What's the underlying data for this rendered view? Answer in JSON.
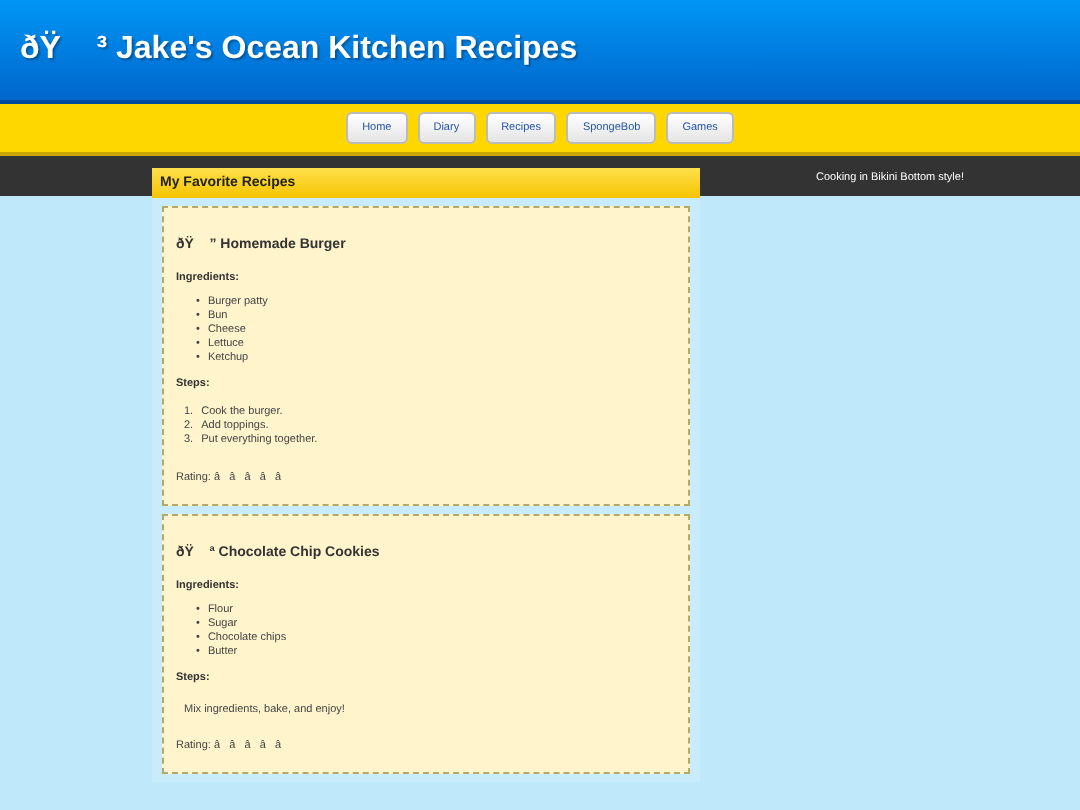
{
  "header": {
    "title": "ðŸ    ³ Jake's Ocean Kitchen Recipes"
  },
  "nav": [
    {
      "label": "Home"
    },
    {
      "label": "Diary"
    },
    {
      "label": "Recipes"
    },
    {
      "label": "SpongeBob"
    },
    {
      "label": "Games"
    }
  ],
  "main": {
    "heading": "My Favorite Recipes",
    "recipes": [
      {
        "title": "ðŸ    ” Homemade Burger",
        "ingredients_label": "Ingredients:",
        "ingredients": [
          {
            "marker": "•",
            "text": "Burger patty"
          },
          {
            "marker": "•",
            "text": "Bun"
          },
          {
            "marker": "•",
            "text": "Cheese"
          },
          {
            "marker": "•",
            "text": "Lettuce"
          },
          {
            "marker": "•",
            "text": "Ketchup"
          }
        ],
        "steps_label": "Steps:",
        "steps_list": [
          {
            "marker": "1.",
            "text": "Cook the burger."
          },
          {
            "marker": "2.",
            "text": "Add toppings."
          },
          {
            "marker": "3.",
            "text": "Put everything together."
          }
        ],
        "rating": "Rating: â   â   â   â   â"
      },
      {
        "title": "ðŸ    ª Chocolate Chip Cookies",
        "ingredients_label": "Ingredients:",
        "ingredients": [
          {
            "marker": "•",
            "text": "Flour"
          },
          {
            "marker": "•",
            "text": "Sugar"
          },
          {
            "marker": "•",
            "text": "Chocolate chips"
          },
          {
            "marker": "•",
            "text": "Butter"
          }
        ],
        "steps_label": "Steps:",
        "steps_text": "Mix ingredients, bake, and enjoy!",
        "rating": "Rating: â   â   â   â   â"
      }
    ]
  },
  "sidebar": {
    "text": "Cooking in Bikini Bottom style!"
  }
}
